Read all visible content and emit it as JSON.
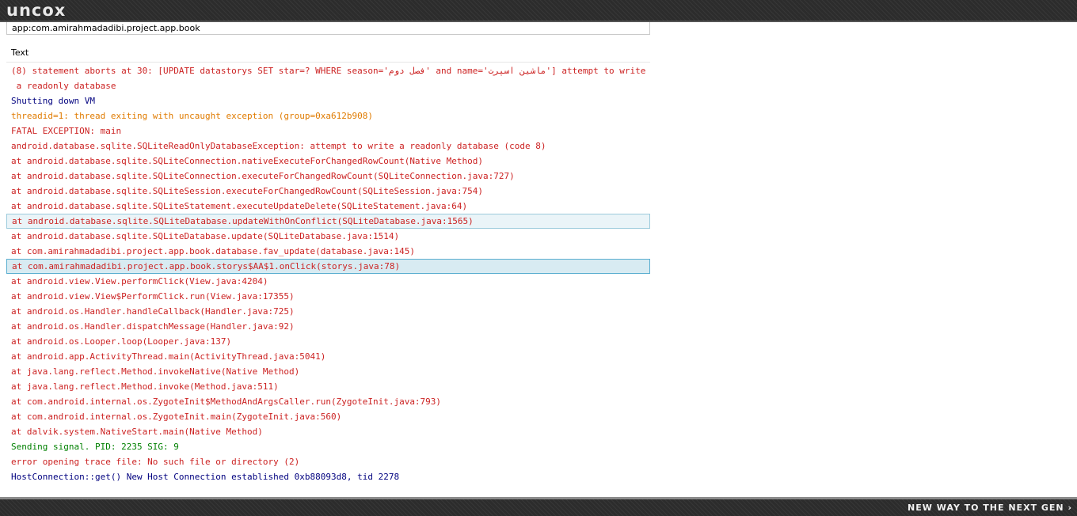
{
  "header": {
    "logo": "uncox"
  },
  "footer": {
    "tagline": "NEW WAY TO THE NEXT GEN ›"
  },
  "logcat": {
    "filter_value": "app:com.amirahmadadibi.project.app.book",
    "column_header": "Text",
    "colors": {
      "error": "#cc2222",
      "warn": "#e07b00",
      "info": "#008000",
      "debug": "#00007f"
    },
    "rows": [
      {
        "text": "(8) statement aborts at 30: [UPDATE datastorys SET star=? WHERE season='فصل دوم' and name='ماشین اسپرت'] attempt to write",
        "level": "error",
        "state": ""
      },
      {
        "text": " a readonly database",
        "level": "error",
        "state": ""
      },
      {
        "text": "Shutting down VM",
        "level": "debug",
        "state": ""
      },
      {
        "text": "threadid=1: thread exiting with uncaught exception (group=0xa612b908)",
        "level": "warn",
        "state": ""
      },
      {
        "text": "FATAL EXCEPTION: main",
        "level": "error",
        "state": ""
      },
      {
        "text": "android.database.sqlite.SQLiteReadOnlyDatabaseException: attempt to write a readonly database (code 8)",
        "level": "error",
        "state": ""
      },
      {
        "text": "at android.database.sqlite.SQLiteConnection.nativeExecuteForChangedRowCount(Native Method)",
        "level": "error",
        "state": ""
      },
      {
        "text": "at android.database.sqlite.SQLiteConnection.executeForChangedRowCount(SQLiteConnection.java:727)",
        "level": "error",
        "state": ""
      },
      {
        "text": "at android.database.sqlite.SQLiteSession.executeForChangedRowCount(SQLiteSession.java:754)",
        "level": "error",
        "state": ""
      },
      {
        "text": "at android.database.sqlite.SQLiteStatement.executeUpdateDelete(SQLiteStatement.java:64)",
        "level": "error",
        "state": ""
      },
      {
        "text": "at android.database.sqlite.SQLiteDatabase.updateWithOnConflict(SQLiteDatabase.java:1565)",
        "level": "error",
        "state": "highlighted"
      },
      {
        "text": "at android.database.sqlite.SQLiteDatabase.update(SQLiteDatabase.java:1514)",
        "level": "error",
        "state": ""
      },
      {
        "text": "at com.amirahmadadibi.project.app.book.database.fav_update(database.java:145)",
        "level": "error",
        "state": ""
      },
      {
        "text": "at com.amirahmadadibi.project.app.book.storys$AA$1.onClick(storys.java:78)",
        "level": "error",
        "state": "selected"
      },
      {
        "text": "at android.view.View.performClick(View.java:4204)",
        "level": "error",
        "state": ""
      },
      {
        "text": "at android.view.View$PerformClick.run(View.java:17355)",
        "level": "error",
        "state": ""
      },
      {
        "text": "at android.os.Handler.handleCallback(Handler.java:725)",
        "level": "error",
        "state": ""
      },
      {
        "text": "at android.os.Handler.dispatchMessage(Handler.java:92)",
        "level": "error",
        "state": ""
      },
      {
        "text": "at android.os.Looper.loop(Looper.java:137)",
        "level": "error",
        "state": ""
      },
      {
        "text": "at android.app.ActivityThread.main(ActivityThread.java:5041)",
        "level": "error",
        "state": ""
      },
      {
        "text": "at java.lang.reflect.Method.invokeNative(Native Method)",
        "level": "error",
        "state": ""
      },
      {
        "text": "at java.lang.reflect.Method.invoke(Method.java:511)",
        "level": "error",
        "state": ""
      },
      {
        "text": "at com.android.internal.os.ZygoteInit$MethodAndArgsCaller.run(ZygoteInit.java:793)",
        "level": "error",
        "state": ""
      },
      {
        "text": "at com.android.internal.os.ZygoteInit.main(ZygoteInit.java:560)",
        "level": "error",
        "state": ""
      },
      {
        "text": "at dalvik.system.NativeStart.main(Native Method)",
        "level": "error",
        "state": ""
      },
      {
        "text": "Sending signal. PID: 2235 SIG: 9",
        "level": "info",
        "state": ""
      },
      {
        "text": "error opening trace file: No such file or directory (2)",
        "level": "error",
        "state": ""
      },
      {
        "text": "HostConnection::get() New Host Connection established 0xb88093d8, tid 2278",
        "level": "debug",
        "state": ""
      }
    ]
  }
}
